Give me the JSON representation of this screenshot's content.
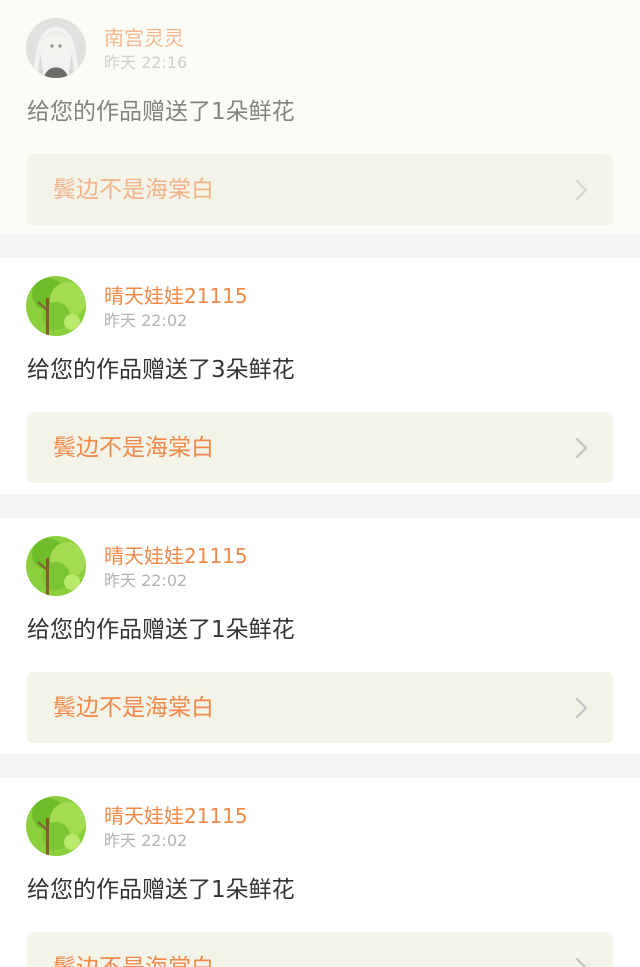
{
  "notifications": [
    {
      "username": "南宫灵灵",
      "time": "昨天 22:16",
      "message": "给您的作品赠送了1朵鲜花",
      "work_title": "鬓边不是海棠白",
      "avatar_icon": "anime-girl-avatar"
    },
    {
      "username": "晴天娃娃21115",
      "time": "昨天 22:02",
      "message": "给您的作品赠送了3朵鲜花",
      "work_title": "鬓边不是海棠白",
      "avatar_icon": "green-tree-avatar"
    },
    {
      "username": "晴天娃娃21115",
      "time": "昨天 22:02",
      "message": "给您的作品赠送了1朵鲜花",
      "work_title": "鬓边不是海棠白",
      "avatar_icon": "green-tree-avatar"
    },
    {
      "username": "晴天娃娃21115",
      "time": "昨天 22:02",
      "message": "给您的作品赠送了1朵鲜花",
      "work_title": "鬓边不是海棠白",
      "avatar_icon": "green-tree-avatar"
    }
  ],
  "colors": {
    "accent": "#f08a4b",
    "link_background": "#f3f3e8",
    "page_background": "#f4f4f4"
  }
}
